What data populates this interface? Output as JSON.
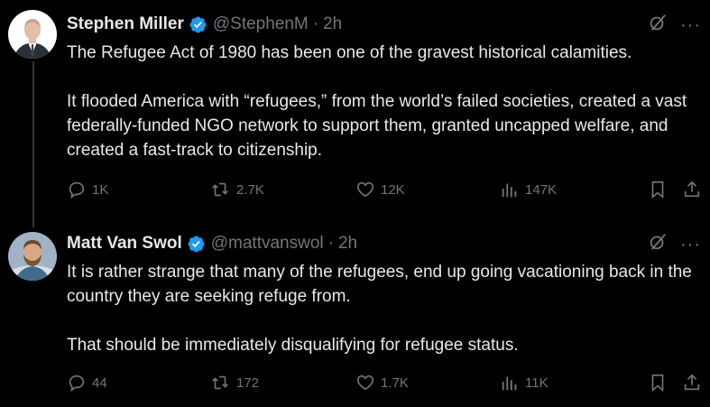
{
  "tweets": [
    {
      "author": {
        "name": "Stephen Miller",
        "handle": "@StephenM",
        "verified": true,
        "avatar": "man-in-suit-avatar"
      },
      "time": "2h",
      "dot": "·",
      "paragraphs": [
        "The Refugee Act of 1980 has been one of the gravest historical calamities.",
        "It flooded America with “refugees,” from the world’s failed societies, created a vast federally-funded NGO network to support them, granted uncapped welfare, and created a fast-track to citizenship."
      ],
      "metrics": {
        "replies": "1K",
        "reposts": "2.7K",
        "likes": "12K",
        "views": "147K"
      }
    },
    {
      "author": {
        "name": "Matt Van Swol",
        "handle": "@mattvanswol",
        "verified": true,
        "avatar": "bearded-man-avatar"
      },
      "time": "2h",
      "dot": "·",
      "paragraphs": [
        "It is rather strange that many of the refugees, end up going vacationing back in the country they are seeking refuge from.",
        "That should be immediately disqualifying for refugee status."
      ],
      "metrics": {
        "replies": "44",
        "reposts": "172",
        "likes": "1.7K",
        "views": "11K"
      }
    }
  ],
  "icons": {
    "more": "···",
    "verified_color": "#1d9bf0",
    "metric_color": "#71767b",
    "text_color": "#e7e9ea",
    "background": "#000000"
  }
}
